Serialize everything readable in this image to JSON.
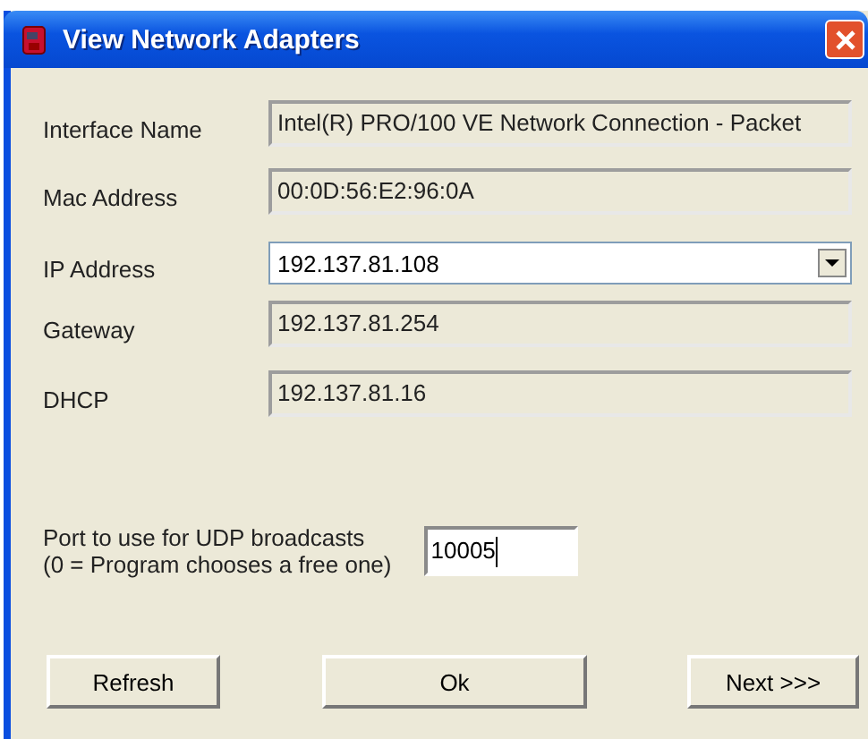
{
  "window": {
    "title": "View Network Adapters"
  },
  "fields": [
    {
      "kind": "readonly",
      "label": "Interface Name",
      "value": "Intel(R) PRO/100 VE Network Connection - Packet"
    },
    {
      "kind": "readonly",
      "label": "Mac Address",
      "value": "00:0D:56:E2:96:0A"
    },
    {
      "kind": "dropdown",
      "label": "IP Address",
      "value": "192.137.81.108"
    },
    {
      "kind": "readonly",
      "label": "Gateway",
      "value": "192.137.81.254"
    },
    {
      "kind": "readonly",
      "label": "DHCP",
      "value": "192.137.81.16"
    }
  ],
  "port": {
    "label_lines": [
      "Port to use for UDP broadcasts",
      "(0 = Program chooses a free one)"
    ],
    "value": "10005"
  },
  "buttons": [
    "Refresh",
    "Ok",
    "Next >>>"
  ]
}
